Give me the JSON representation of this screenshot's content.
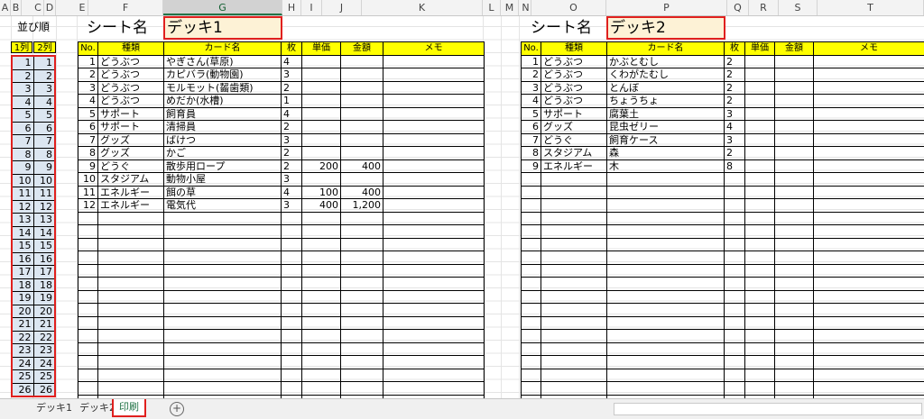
{
  "columns": [
    "A",
    "B",
    "C",
    "D",
    "E",
    "F",
    "G",
    "H",
    "I",
    "J",
    "K",
    "L",
    "M",
    "N",
    "O",
    "P",
    "Q",
    "R",
    "S",
    "T"
  ],
  "order_header": {
    "title": "並び順",
    "col1": "1列",
    "col2": "2列"
  },
  "order_rows": [
    [
      1,
      1
    ],
    [
      2,
      2
    ],
    [
      3,
      3
    ],
    [
      4,
      4
    ],
    [
      5,
      5
    ],
    [
      6,
      6
    ],
    [
      7,
      7
    ],
    [
      8,
      8
    ],
    [
      9,
      9
    ],
    [
      10,
      10
    ],
    [
      11,
      11
    ],
    [
      12,
      12
    ],
    [
      13,
      13
    ],
    [
      14,
      14
    ],
    [
      15,
      15
    ],
    [
      16,
      16
    ],
    [
      17,
      17
    ],
    [
      18,
      18
    ],
    [
      19,
      19
    ],
    [
      20,
      20
    ],
    [
      21,
      21
    ],
    [
      22,
      22
    ],
    [
      23,
      23
    ],
    [
      24,
      24
    ],
    [
      25,
      25
    ],
    [
      26,
      26
    ]
  ],
  "deck1": {
    "sheet_label": "シート名",
    "deck_name": "デッキ1",
    "headers": [
      "No.",
      "種類",
      "カード名",
      "枚",
      "単価",
      "金額",
      "メモ"
    ],
    "rows": [
      [
        "1",
        "どうぶつ",
        "やぎさん(草原)",
        "4",
        "",
        "",
        ""
      ],
      [
        "2",
        "どうぶつ",
        "カピバラ(動物園)",
        "3",
        "",
        "",
        ""
      ],
      [
        "3",
        "どうぶつ",
        "モルモット(齧歯類)",
        "2",
        "",
        "",
        ""
      ],
      [
        "4",
        "どうぶつ",
        "めだか(水槽)",
        "1",
        "",
        "",
        ""
      ],
      [
        "5",
        "サポート",
        "飼育員",
        "4",
        "",
        "",
        ""
      ],
      [
        "6",
        "サポート",
        "清掃員",
        "2",
        "",
        "",
        ""
      ],
      [
        "7",
        "グッズ",
        "ばけつ",
        "3",
        "",
        "",
        ""
      ],
      [
        "8",
        "グッズ",
        "かご",
        "2",
        "",
        "",
        ""
      ],
      [
        "9",
        "どうぐ",
        "散歩用ロープ",
        "2",
        "200",
        "400",
        ""
      ],
      [
        "10",
        "スタジアム",
        "動物小屋",
        "3",
        "",
        "",
        ""
      ],
      [
        "11",
        "エネルギー",
        "餌の草",
        "4",
        "100",
        "400",
        ""
      ],
      [
        "12",
        "エネルギー",
        "電気代",
        "3",
        "400",
        "1,200",
        ""
      ]
    ]
  },
  "deck2": {
    "sheet_label": "シート名",
    "deck_name": "デッキ2",
    "headers": [
      "No.",
      "種類",
      "カード名",
      "枚",
      "単価",
      "金額",
      "メモ"
    ],
    "rows": [
      [
        "1",
        "どうぶつ",
        "かぶとむし",
        "2",
        "",
        "",
        ""
      ],
      [
        "2",
        "どうぶつ",
        "くわがたむし",
        "2",
        "",
        "",
        ""
      ],
      [
        "3",
        "どうぶつ",
        "とんぼ",
        "2",
        "",
        "",
        ""
      ],
      [
        "4",
        "どうぶつ",
        "ちょうちょ",
        "2",
        "",
        "",
        ""
      ],
      [
        "5",
        "サポート",
        "腐葉土",
        "3",
        "",
        "",
        ""
      ],
      [
        "6",
        "グッズ",
        "昆虫ゼリー",
        "4",
        "",
        "",
        ""
      ],
      [
        "7",
        "どうぐ",
        "飼育ケース",
        "3",
        "",
        "",
        ""
      ],
      [
        "8",
        "スタジアム",
        "森",
        "2",
        "",
        "",
        ""
      ],
      [
        "9",
        "エネルギー",
        "木",
        "8",
        "",
        "",
        ""
      ]
    ]
  },
  "tabs": {
    "t1": "デッキ1",
    "t2": "デッキ2",
    "t3": "印刷",
    "add_icon": "plus-icon"
  },
  "colors": {
    "header_yellow": "#ffff00",
    "order_blue": "#dce6f1",
    "highlight_red": "#e0201e",
    "deck_fill": "#fdf2d6"
  }
}
